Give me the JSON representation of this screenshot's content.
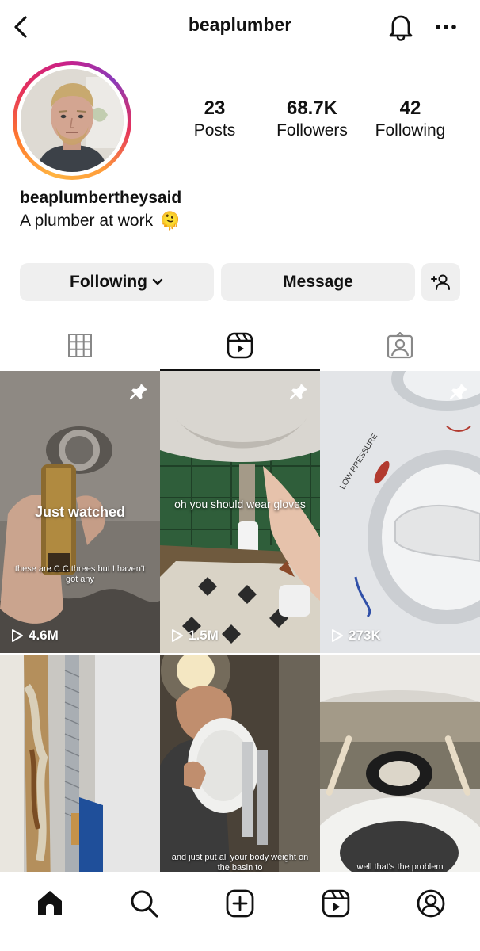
{
  "header": {
    "title": "beaplumber",
    "back_icon": "chevron-left-icon",
    "bell_icon": "bell-icon",
    "more_icon": "more-horizontal-icon"
  },
  "profile": {
    "stats": [
      {
        "value": "23",
        "label": "Posts"
      },
      {
        "value": "68.7K",
        "label": "Followers"
      },
      {
        "value": "42",
        "label": "Following"
      }
    ],
    "name": "beaplumbertheysaid",
    "bio": "A plumber at work",
    "bio_emoji": "🫠"
  },
  "actions": {
    "following": "Following",
    "message": "Message",
    "add_user_icon": "add-person-icon"
  },
  "tabs": [
    "grid-icon",
    "reels-icon",
    "tagged-icon"
  ],
  "reels": [
    {
      "overlay": "Just watched",
      "caption": "these are C C threes but I haven't got any",
      "views": "4.6M",
      "pinned": true
    },
    {
      "overlay": "oh you should wear gloves",
      "views": "1.5M",
      "pinned": true
    },
    {
      "label": "LOW PRESSURE",
      "views": "273K",
      "pinned": true
    },
    {},
    {
      "caption": "and just put all your body weight on the basin to"
    },
    {
      "caption": "well that's the problem"
    }
  ],
  "nav": [
    "home-icon",
    "search-icon",
    "create-icon",
    "reels-icon",
    "profile-icon"
  ],
  "colors": {
    "accent_button": "#efefef",
    "text": "#111111"
  }
}
